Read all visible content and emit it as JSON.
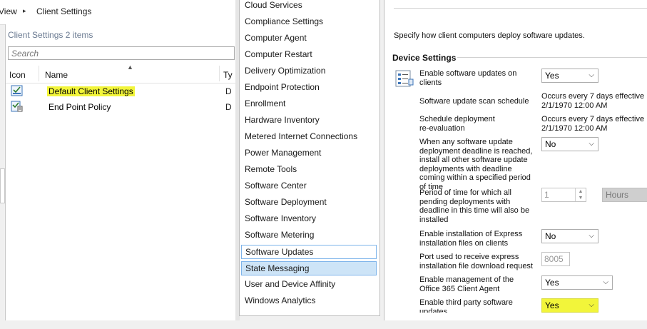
{
  "breadcrumb": {
    "root": "View",
    "separator": "▸",
    "current": "Client Settings"
  },
  "list_pane": {
    "title": "Client Settings",
    "count": "2 items",
    "search_placeholder": "Search",
    "columns": [
      "Icon",
      "Name",
      "Ty"
    ],
    "rows": [
      {
        "name": "Default Client Settings",
        "type": "D",
        "highlighted": true
      },
      {
        "name": "End Point Policy",
        "type": "D",
        "highlighted": false
      }
    ]
  },
  "categories": [
    "Cloud Services",
    "Compliance Settings",
    "Computer Agent",
    "Computer Restart",
    "Delivery Optimization",
    "Endpoint Protection",
    "Enrollment",
    "Hardware Inventory",
    "Metered Internet Connections",
    "Power Management",
    "Remote Tools",
    "Software Center",
    "Software Deployment",
    "Software Inventory",
    "Software Metering",
    "Software Updates",
    "State Messaging",
    "User and Device Affinity",
    "Windows Analytics"
  ],
  "selected_category": "State Messaging",
  "focused_category": "Software Updates",
  "settings_panel": {
    "description": "Specify how client computers deploy software updates.",
    "group_title": "Device Settings",
    "settings": [
      {
        "label": "Enable software updates on clients",
        "value": "Yes"
      },
      {
        "label": "Software update scan schedule",
        "value": "Occurs every 7 days effective 2/1/1970 12:00 AM"
      },
      {
        "label": "Schedule deployment re-evaluation",
        "value": "Occurs every 7 days effective 2/1/1970 12:00 AM"
      },
      {
        "label": "When any software update deployment deadline is reached, install all other software update deployments with deadline coming within a specified period of time",
        "value": "No"
      },
      {
        "label": "Period of time for which all pending deployments with deadline in this time will also be installed",
        "value": "1",
        "unit": "Hours"
      },
      {
        "label": "Enable installation of Express installation files on clients",
        "value": "No"
      },
      {
        "label": "Port used to receive express installation file download request",
        "value": "8005"
      },
      {
        "label": "Enable management of the Office 365 Client Agent",
        "value": "Yes"
      },
      {
        "label": "Enable third party software updates",
        "value": "Yes"
      }
    ]
  },
  "colors": {
    "highlight": "#f2f53a",
    "selection": "#cde4f7",
    "selection_border": "#7eb4ea",
    "title_gray": "#6a7a91"
  },
  "icons": [
    "client-settings-icon",
    "policy-icon",
    "device-settings-icon",
    "chevron-down-icon",
    "spin-arrows-icon"
  ]
}
